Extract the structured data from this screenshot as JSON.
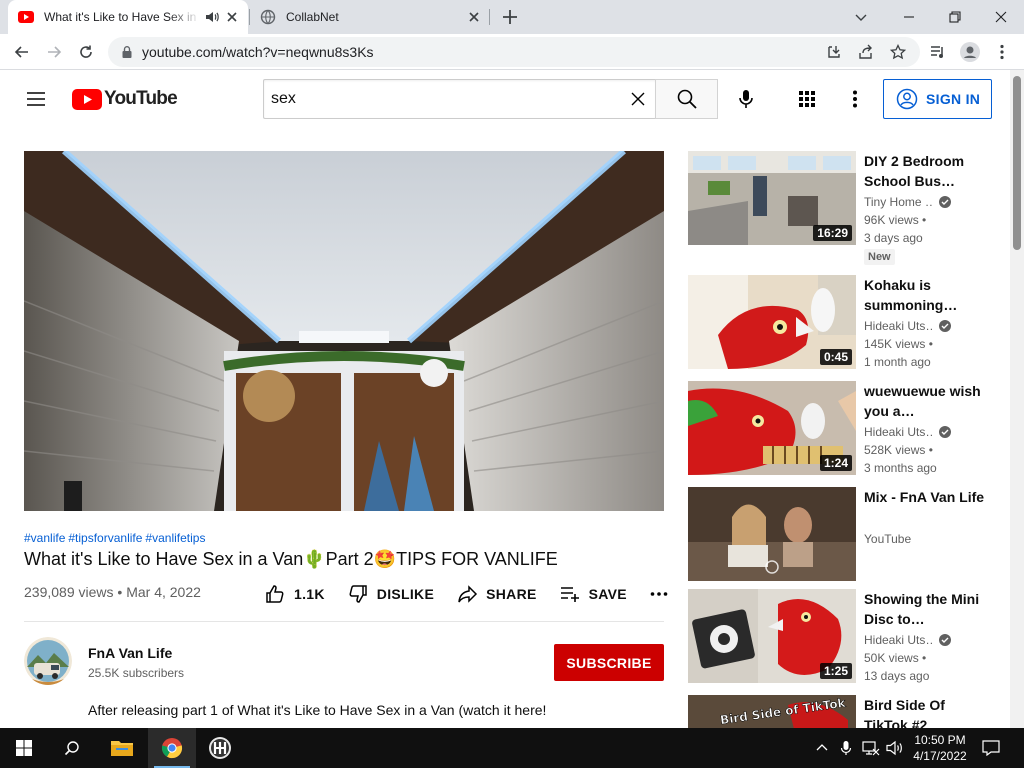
{
  "browser": {
    "tabs": [
      {
        "title": "What it's Like to Have Sex in a Van",
        "active": true
      },
      {
        "title": "CollabNet",
        "active": false
      }
    ],
    "url": "youtube.com/watch?v=neqwnu8s3Ks"
  },
  "masthead": {
    "logo_text": "YouTube",
    "search_value": "sex",
    "signin_label": "SIGN IN"
  },
  "video": {
    "hashtags": [
      "#vanlife",
      "#tipsforvanlife",
      "#vanlifetips"
    ],
    "title": "What it's Like to Have Sex in a Van🌵Part 2🤩TIPS FOR VANLIFE",
    "views": "239,089 views",
    "date": "Mar 4, 2022",
    "actions": {
      "like": "1.1K",
      "dislike": "DISLIKE",
      "share": "SHARE",
      "save": "SAVE"
    },
    "channel": {
      "name": "FnA Van Life",
      "subscribers": "25.5K subscribers",
      "subscribe_label": "SUBSCRIBE"
    },
    "description": "After releasing part 1 of What it's Like to Have Sex in a Van (watch it here!"
  },
  "recommendations": [
    {
      "title": "DIY 2 Bedroom School Bus…",
      "channel": "Tiny Home …",
      "verified": true,
      "views": "96K views",
      "age": "3 days ago",
      "badge": "New",
      "duration": "16:29"
    },
    {
      "title": "Kohaku is summoning…",
      "channel": "Hideaki Uts…",
      "verified": true,
      "views": "145K views",
      "age": "1 month ago",
      "duration": "0:45"
    },
    {
      "title": "wuewuewue wish you a…",
      "channel": "Hideaki Uts…",
      "verified": true,
      "views": "528K views",
      "age": "3 months ago",
      "duration": "1:24"
    },
    {
      "title": "Mix - FnA Van Life",
      "channel": "YouTube",
      "verified": false
    },
    {
      "title": "Showing the Mini Disc to…",
      "channel": "Hideaki Uts…",
      "verified": true,
      "views": "50K views",
      "age": "13 days ago",
      "duration": "1:25"
    },
    {
      "title": "Bird Side Of TikTok #2",
      "thumb_text": "Bird Side of TikTok"
    }
  ],
  "taskbar": {
    "time": "10:50 PM",
    "date": "4/17/2022"
  },
  "colors": {
    "accent_blue": "#065fd4",
    "subscribe_red": "#cc0000",
    "yt_red": "#ff0000"
  }
}
